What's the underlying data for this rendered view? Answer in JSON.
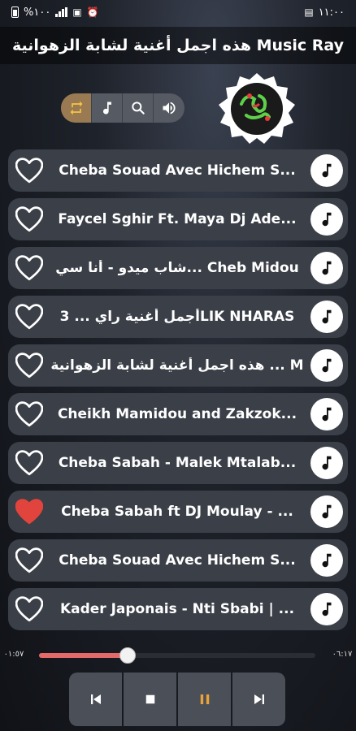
{
  "status_bar": {
    "battery": "%١٠٠",
    "time": "١١:٠٠"
  },
  "app": {
    "title": "هذه اجمل أغنية لشابة الزهوانية Music Ray",
    "logo_icon": "artist-logo-icon"
  },
  "controls": {
    "repeat_icon": "repeat-icon",
    "music_icon": "music-note-icon",
    "search_icon": "search-icon",
    "volume_icon": "volume-icon"
  },
  "songs": [
    {
      "title": "Cheba Souad Avec Hichem S...",
      "favorite": false
    },
    {
      "title": "Faycel Sghir Ft. Maya Dj Ade...",
      "favorite": false
    },
    {
      "title": "شاب ميدو - أنا سي... Cheb Midou",
      "favorite": false
    },
    {
      "title": "أجمل أغنية راي ... 3LIK NHARAS",
      "favorite": false
    },
    {
      "title": "هذه اجمل أغنية لشابة الزهوانية ... M",
      "favorite": false
    },
    {
      "title": "Cheikh Mamidou and Zakzok...",
      "favorite": false
    },
    {
      "title": "Cheba Sabah - Malek Mtalab...",
      "favorite": false
    },
    {
      "title": "Cheba Sabah ft DJ Moulay - ...",
      "favorite": true
    },
    {
      "title": "Cheba Souad Avec Hichem S...",
      "favorite": false
    },
    {
      "title": "Kader Japonais - Nti Sbabi | ...",
      "favorite": false
    }
  ],
  "player": {
    "elapsed": "٠١:٥٧",
    "duration": "٠٦:١٧",
    "progress": 0.32,
    "prev_icon": "skip-previous-icon",
    "stop_icon": "stop-icon",
    "pause_icon": "pause-icon",
    "next_icon": "skip-next-icon"
  },
  "colors": {
    "accent": "#e8a33a",
    "favorite": "#e0443c",
    "progress": "#e46a6a"
  }
}
